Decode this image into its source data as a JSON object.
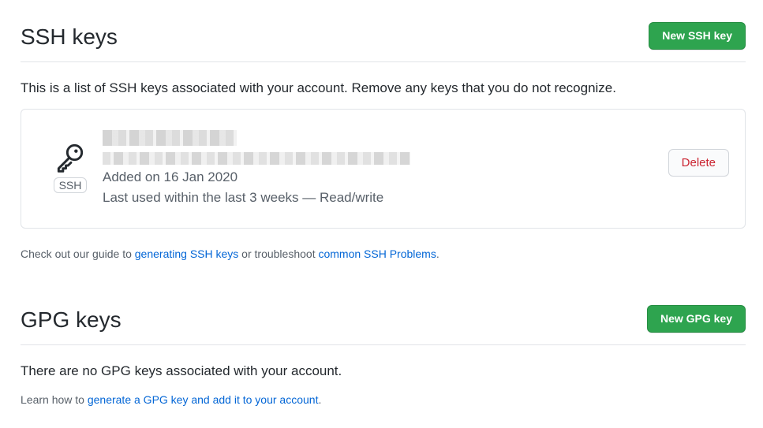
{
  "ssh": {
    "title": "SSH keys",
    "new_button": "New SSH key",
    "intro": "This is a list of SSH keys associated with your account. Remove any keys that you do not recognize.",
    "key": {
      "badge": "SSH",
      "added": "Added on 16 Jan 2020",
      "last_used": "Last used within the last 3 weeks — Read/write",
      "delete_label": "Delete"
    },
    "help": {
      "prefix": "Check out our guide to ",
      "link1": "generating SSH keys",
      "middle": " or troubleshoot ",
      "link2": "common SSH Problems",
      "suffix": "."
    }
  },
  "gpg": {
    "title": "GPG keys",
    "new_button": "New GPG key",
    "empty": "There are no GPG keys associated with your account.",
    "help": {
      "prefix": "Learn how to ",
      "link": "generate a GPG key and add it to your account",
      "suffix": "."
    }
  },
  "icons": {
    "key": "key-icon"
  },
  "colors": {
    "primary_button": "#2ea44f",
    "danger": "#cb2431",
    "link": "#0366d6"
  }
}
